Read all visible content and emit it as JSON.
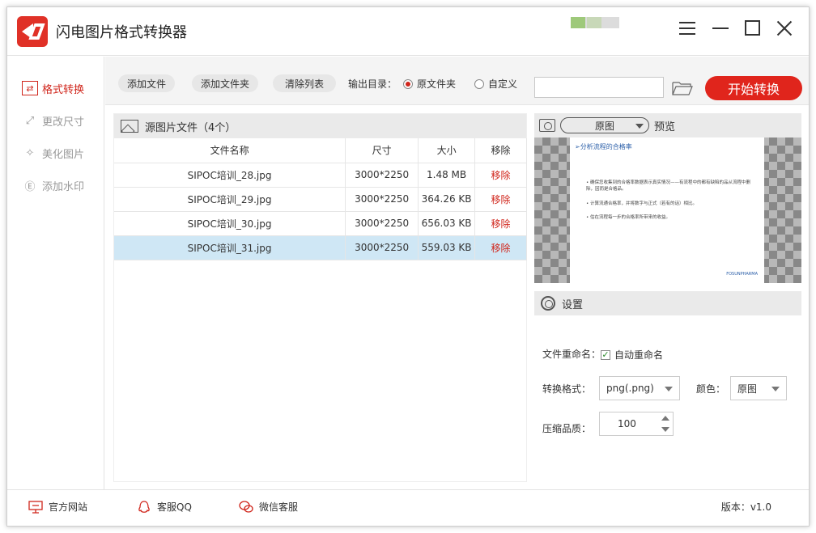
{
  "app": {
    "title": "闪电图片格式转换器",
    "accent": "#e0251c"
  },
  "sidebar": {
    "items": [
      {
        "label": "格式转换",
        "icon": "convert-icon",
        "active": true
      },
      {
        "label": "更改尺寸",
        "icon": "resize-icon",
        "active": false
      },
      {
        "label": "美化图片",
        "icon": "beautify-icon",
        "active": false
      },
      {
        "label": "添加水印",
        "icon": "watermark-icon",
        "active": false
      }
    ]
  },
  "toolbar": {
    "add_file": "添加文件",
    "add_folder": "添加文件夹",
    "clear_list": "清除列表",
    "output_label": "输出目录：",
    "radio_original": "原文件夹",
    "radio_custom": "自定义",
    "path_value": "",
    "start": "开始转换"
  },
  "file_panel": {
    "title": "源图片文件（4个）",
    "columns": [
      "文件名称",
      "尺寸",
      "大小",
      "移除"
    ],
    "rows": [
      {
        "name": "SIPOC培训_28.jpg",
        "size": "3000*2250",
        "bytes": "1.48 MB",
        "remove": "移除"
      },
      {
        "name": "SIPOC培训_29.jpg",
        "size": "3000*2250",
        "bytes": "364.26 KB",
        "remove": "移除"
      },
      {
        "name": "SIPOC培训_30.jpg",
        "size": "3000*2250",
        "bytes": "656.03 KB",
        "remove": "移除"
      },
      {
        "name": "SIPOC培训_31.jpg",
        "size": "3000*2250",
        "bytes": "559.03 KB",
        "remove": "移除"
      }
    ]
  },
  "preview": {
    "select_value": "原图",
    "label": "预览",
    "slide_title": "➢分析流程的合格率",
    "slide_lines": [
      "• 确保您收集到的合格率数据表示真实情况——有流程中的都有缺陷的品从流程中删除，因而是合格品。",
      "• 计算流通合格率，并将数字与正式（若有的话）相比。",
      "• 估在流程每一步的合格率所带来的收益。"
    ],
    "slide_brand": "FOSUNPHARMA"
  },
  "settings": {
    "title": "设置",
    "rename_label": "文件重命名：",
    "rename_option": "自动重命名",
    "format_label": "转换格式：",
    "format_value": "png(.png)",
    "color_label": "颜色：",
    "color_value": "原图",
    "quality_label": "压缩品质：",
    "quality_value": "100"
  },
  "footer": {
    "website": "官方网站",
    "qq": "客服QQ",
    "wechat": "微信客服",
    "version": "版本：v1.0"
  }
}
